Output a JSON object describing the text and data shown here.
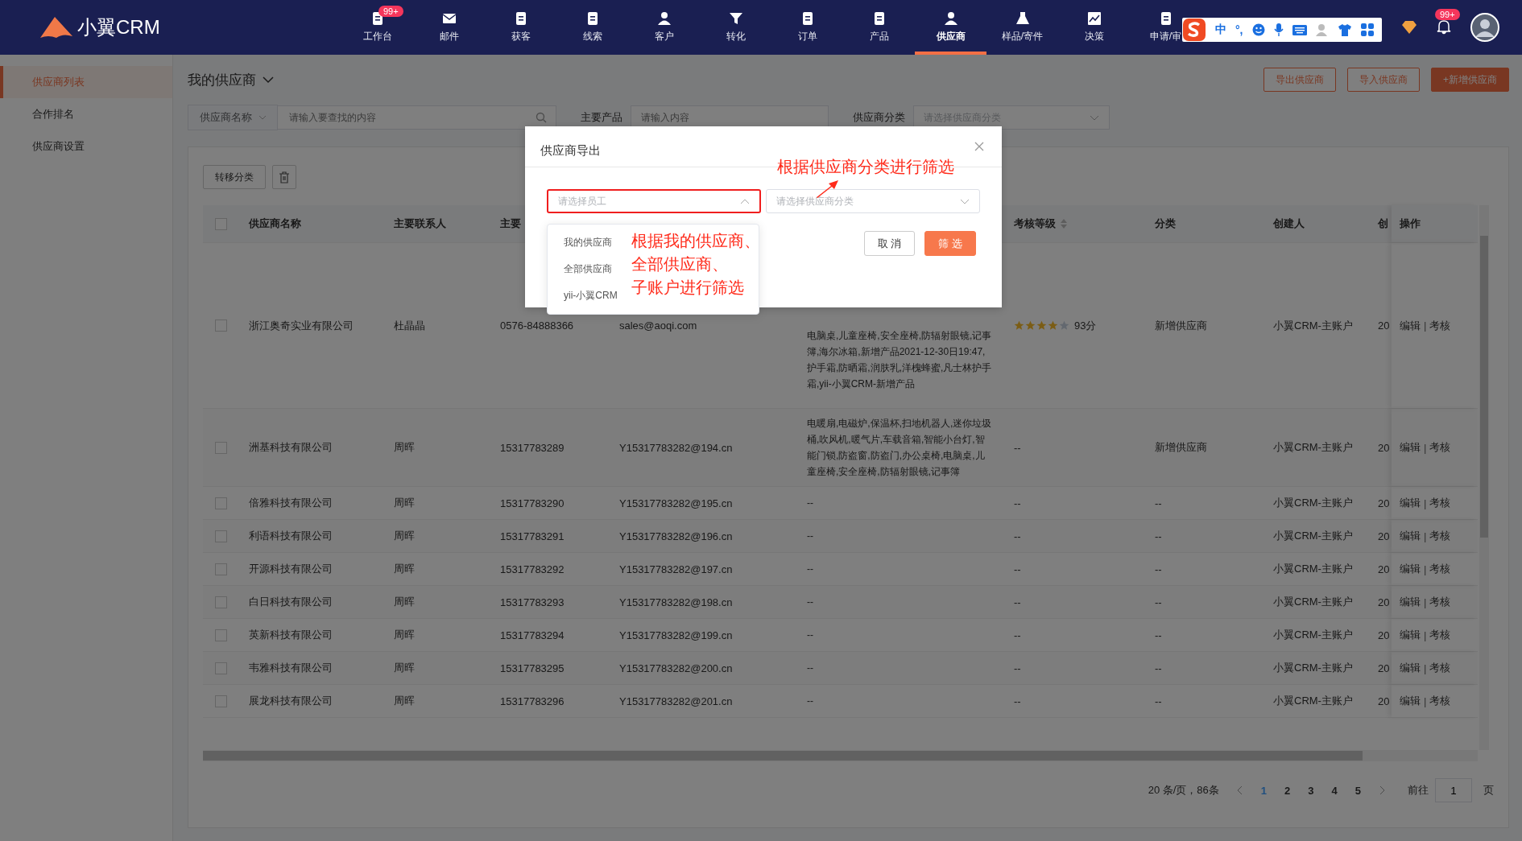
{
  "logo": "小翼CRM",
  "nav": [
    {
      "label": "工作台",
      "badge": "99+",
      "selected": false
    },
    {
      "label": "邮件",
      "selected": false
    },
    {
      "label": "获客",
      "selected": false
    },
    {
      "label": "线索",
      "selected": false
    },
    {
      "label": "客户",
      "selected": false
    },
    {
      "label": "转化",
      "selected": false
    },
    {
      "label": "订单",
      "selected": false
    },
    {
      "label": "产品",
      "selected": false
    },
    {
      "label": "供应商",
      "selected": true
    },
    {
      "label": "样品/寄件",
      "selected": false
    },
    {
      "label": "决策",
      "selected": false
    },
    {
      "label": "申请/审",
      "selected": false
    }
  ],
  "ime": {
    "lang": "中",
    "punct": "°,"
  },
  "bell_badge": "99+",
  "sidebar": [
    {
      "label": "供应商列表",
      "selected": true
    },
    {
      "label": "合作排名",
      "selected": false
    },
    {
      "label": "供应商设置",
      "selected": false
    }
  ],
  "page_title": "我的供应商",
  "header_buttons": [
    {
      "label": "导出供应商",
      "kind": "outline"
    },
    {
      "label": "导入供应商",
      "kind": "outline"
    },
    {
      "label": "+新增供应商",
      "kind": "primary"
    }
  ],
  "filters": {
    "field_select": "供应商名称",
    "search_placeholder": "请输入要查找的内容",
    "product_label": "主要产品",
    "product_placeholder": "请输入内容",
    "category_label": "供应商分类",
    "category_placeholder": "请选择供应商分类"
  },
  "toolbar": {
    "move_button": "转移分类"
  },
  "table": {
    "select_all_checked": false,
    "columns": [
      "供应商名称",
      "主要联系人",
      "主要",
      "",
      "",
      "考核等级",
      "分类",
      "创建人",
      "创",
      "操作"
    ],
    "rows": [
      {
        "checked": false,
        "name": "浙江奥奇实业有限公司",
        "contact": "杜晶晶",
        "phone": "0576-84888366",
        "email": "sales@aoqi.com",
        "products": "电脑桌,儿童座椅,安全座椅,防辐射眼镜,记事簿,海尔冰箱,新增产品2021-12-30日19:47,护手霜,防晒霜,润肤乳,洋槐蜂蜜,凡士林护手霜,yii-小翼CRM-新增产品",
        "stars": 4,
        "score": "93分",
        "category": "新增供应商",
        "creator": "小翼CRM-主账户",
        "created": "20",
        "actions": [
          "编辑",
          "考核"
        ],
        "separator": "|"
      },
      {
        "checked": false,
        "name": "洲基科技有限公司",
        "contact": "周晖",
        "phone": "15317783289",
        "email": "Y15317783282@194.cn",
        "products": "电暖扇,电磁炉,保温杯,扫地机器人,迷你垃圾桶,吹风机,暖气片,车载音箱,智能小台灯,智能门锁,防盗窗,防盗门,办公桌椅,电脑桌,儿童座椅,安全座椅,防辐射眼镜,记事簿",
        "rating": "--",
        "category": "新增供应商",
        "creator": "小翼CRM-主账户",
        "created": "20",
        "actions": [
          "编辑",
          "考核"
        ],
        "separator": "|"
      },
      {
        "checked": false,
        "name": "倍雅科技有限公司",
        "contact": "周晖",
        "phone": "15317783290",
        "email": "Y15317783282@195.cn",
        "products": "--",
        "rating": "--",
        "category": "--",
        "creator": "小翼CRM-主账户",
        "created": "20",
        "actions": [
          "编辑",
          "考核"
        ],
        "separator": "|"
      },
      {
        "checked": false,
        "name": "利语科技有限公司",
        "contact": "周晖",
        "phone": "15317783291",
        "email": "Y15317783282@196.cn",
        "products": "--",
        "rating": "--",
        "category": "--",
        "creator": "小翼CRM-主账户",
        "created": "20",
        "actions": [
          "编辑",
          "考核"
        ],
        "separator": "|"
      },
      {
        "checked": false,
        "name": "开源科技有限公司",
        "contact": "周晖",
        "phone": "15317783292",
        "email": "Y15317783282@197.cn",
        "products": "--",
        "rating": "--",
        "category": "--",
        "creator": "小翼CRM-主账户",
        "created": "20",
        "actions": [
          "编辑",
          "考核"
        ],
        "separator": "|"
      },
      {
        "checked": false,
        "name": "白日科技有限公司",
        "contact": "周晖",
        "phone": "15317783293",
        "email": "Y15317783282@198.cn",
        "products": "--",
        "rating": "--",
        "category": "--",
        "creator": "小翼CRM-主账户",
        "created": "20",
        "actions": [
          "编辑",
          "考核"
        ],
        "separator": "|"
      },
      {
        "checked": false,
        "name": "英新科技有限公司",
        "contact": "周晖",
        "phone": "15317783294",
        "email": "Y15317783282@199.cn",
        "products": "--",
        "rating": "--",
        "category": "--",
        "creator": "小翼CRM-主账户",
        "created": "20",
        "actions": [
          "编辑",
          "考核"
        ],
        "separator": "|"
      },
      {
        "checked": false,
        "name": "韦雅科技有限公司",
        "contact": "周晖",
        "phone": "15317783295",
        "email": "Y15317783282@200.cn",
        "products": "--",
        "rating": "--",
        "category": "--",
        "creator": "小翼CRM-主账户",
        "created": "20",
        "actions": [
          "编辑",
          "考核"
        ],
        "separator": "|"
      },
      {
        "checked": false,
        "name": "展龙科技有限公司",
        "contact": "周晖",
        "phone": "15317783296",
        "email": "Y15317783282@201.cn",
        "products": "--",
        "rating": "--",
        "category": "--",
        "creator": "小翼CRM-主账户",
        "created": "20",
        "actions": [
          "编辑",
          "考核"
        ],
        "separator": "|"
      }
    ]
  },
  "pagination": {
    "summary": "20 条/页，86条",
    "pages": [
      {
        "label": "1",
        "selected": true
      },
      {
        "label": "2",
        "selected": false
      },
      {
        "label": "3",
        "selected": false
      },
      {
        "label": "4",
        "selected": false
      },
      {
        "label": "5",
        "selected": false
      }
    ],
    "goto_label": "前往",
    "goto_value": "1",
    "page_suffix": "页"
  },
  "modal": {
    "title": "供应商导出",
    "employee_placeholder": "请选择员工",
    "category_placeholder": "请选择供应商分类",
    "cancel": "取 消",
    "confirm": "筛 选",
    "dropdown": [
      "我的供应商",
      "全部供应商",
      "yii-小翼CRM"
    ]
  },
  "annotations": [
    {
      "text": "根据供应商分类进行筛选"
    },
    {
      "lines": [
        "根据我的供应商、",
        "全部供应商、",
        "子账户进行筛选"
      ]
    }
  ]
}
